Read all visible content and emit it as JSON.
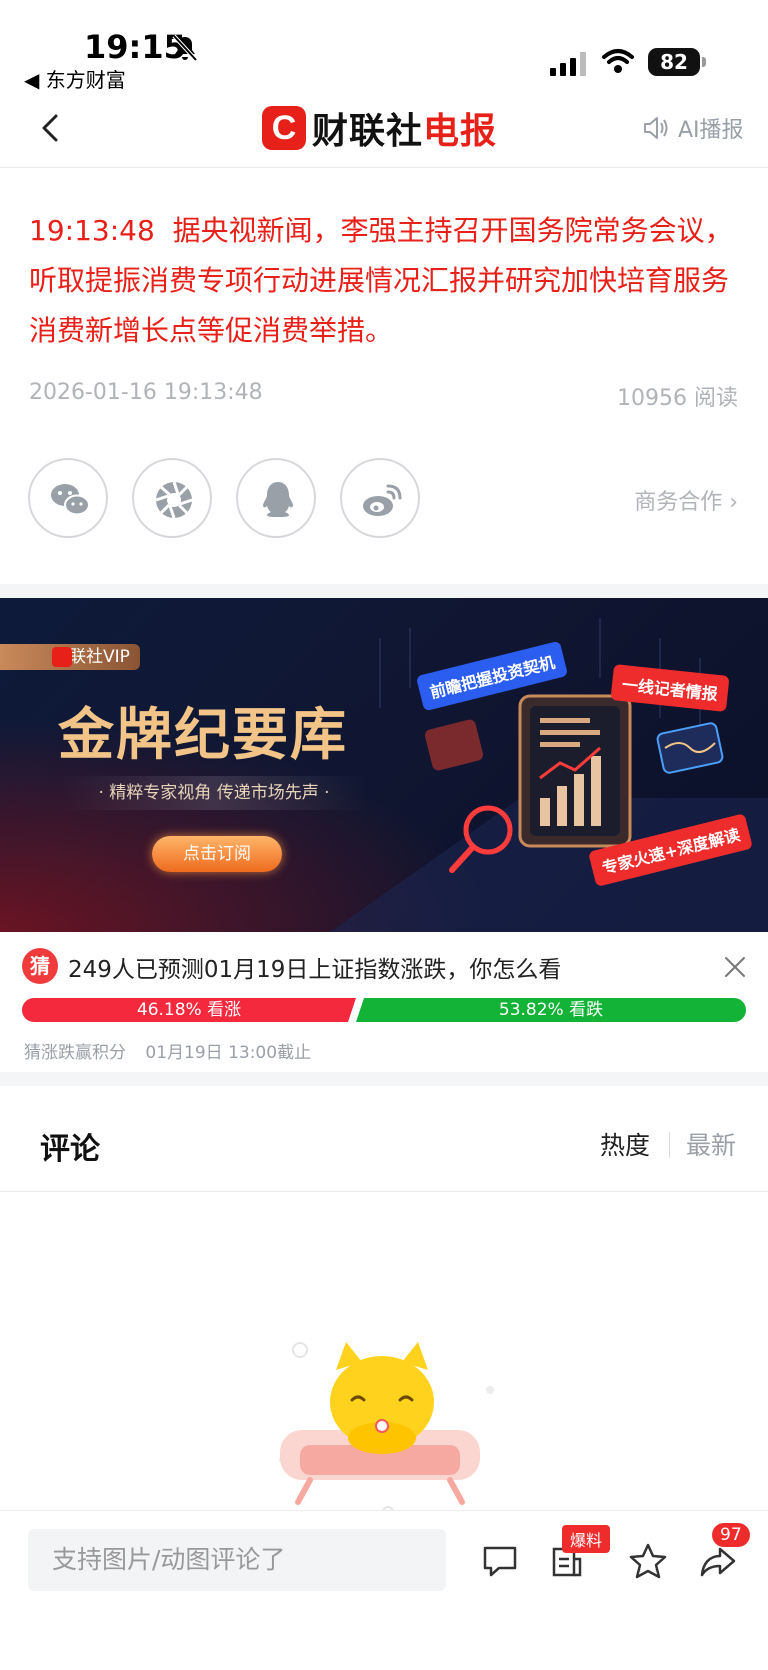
{
  "status_bar": {
    "time": "19:15",
    "back_app": "◀ 东方财富",
    "battery": "82"
  },
  "nav": {
    "logo_c": "C",
    "logo_brand": "财联社",
    "logo_suffix": "电报",
    "ai_label": "AI播报"
  },
  "article": {
    "time": "19:13:48",
    "body": "据央视新闻，李强主持召开国务院常务会议，听取提振消费专项行动进展情况汇报并研究加快培育服务消费新增长点等促消费举措。",
    "date": "2026-01-16 19:13:48",
    "reads": "10956 阅读"
  },
  "share": {
    "biz_link": "商务合作 ›",
    "icons": [
      "wechat-icon",
      "moments-icon",
      "qq-icon",
      "weibo-icon"
    ]
  },
  "banner": {
    "vip_label": "财联社VIP",
    "title": "金牌纪要库",
    "subtitle": "· 精粹专家视角 传递市场先声 ·",
    "cta": "点击订阅",
    "tags": [
      "前瞻把握投资契机",
      "一线记者情报",
      "专家火速+深度解读"
    ]
  },
  "prediction": {
    "icon_label": "猜",
    "title": "249人已预测01月19日上证指数涨跌，你怎么看",
    "up_label": "46.18% 看涨",
    "down_label": "53.82% 看跌",
    "up_ratio": 0.4618,
    "footer_left": "猜涨跌赢积分",
    "footer_right": "01月19日 13:00截止"
  },
  "comments": {
    "title": "评论",
    "sort_hot": "热度",
    "sort_new": "最新"
  },
  "bottom_bar": {
    "input_placeholder": "支持图片/动图评论了",
    "bao_badge": "爆料",
    "share_count": "97"
  },
  "colors": {
    "accent_red": "#e7211a",
    "up": "#f5293e",
    "down": "#12b336"
  }
}
